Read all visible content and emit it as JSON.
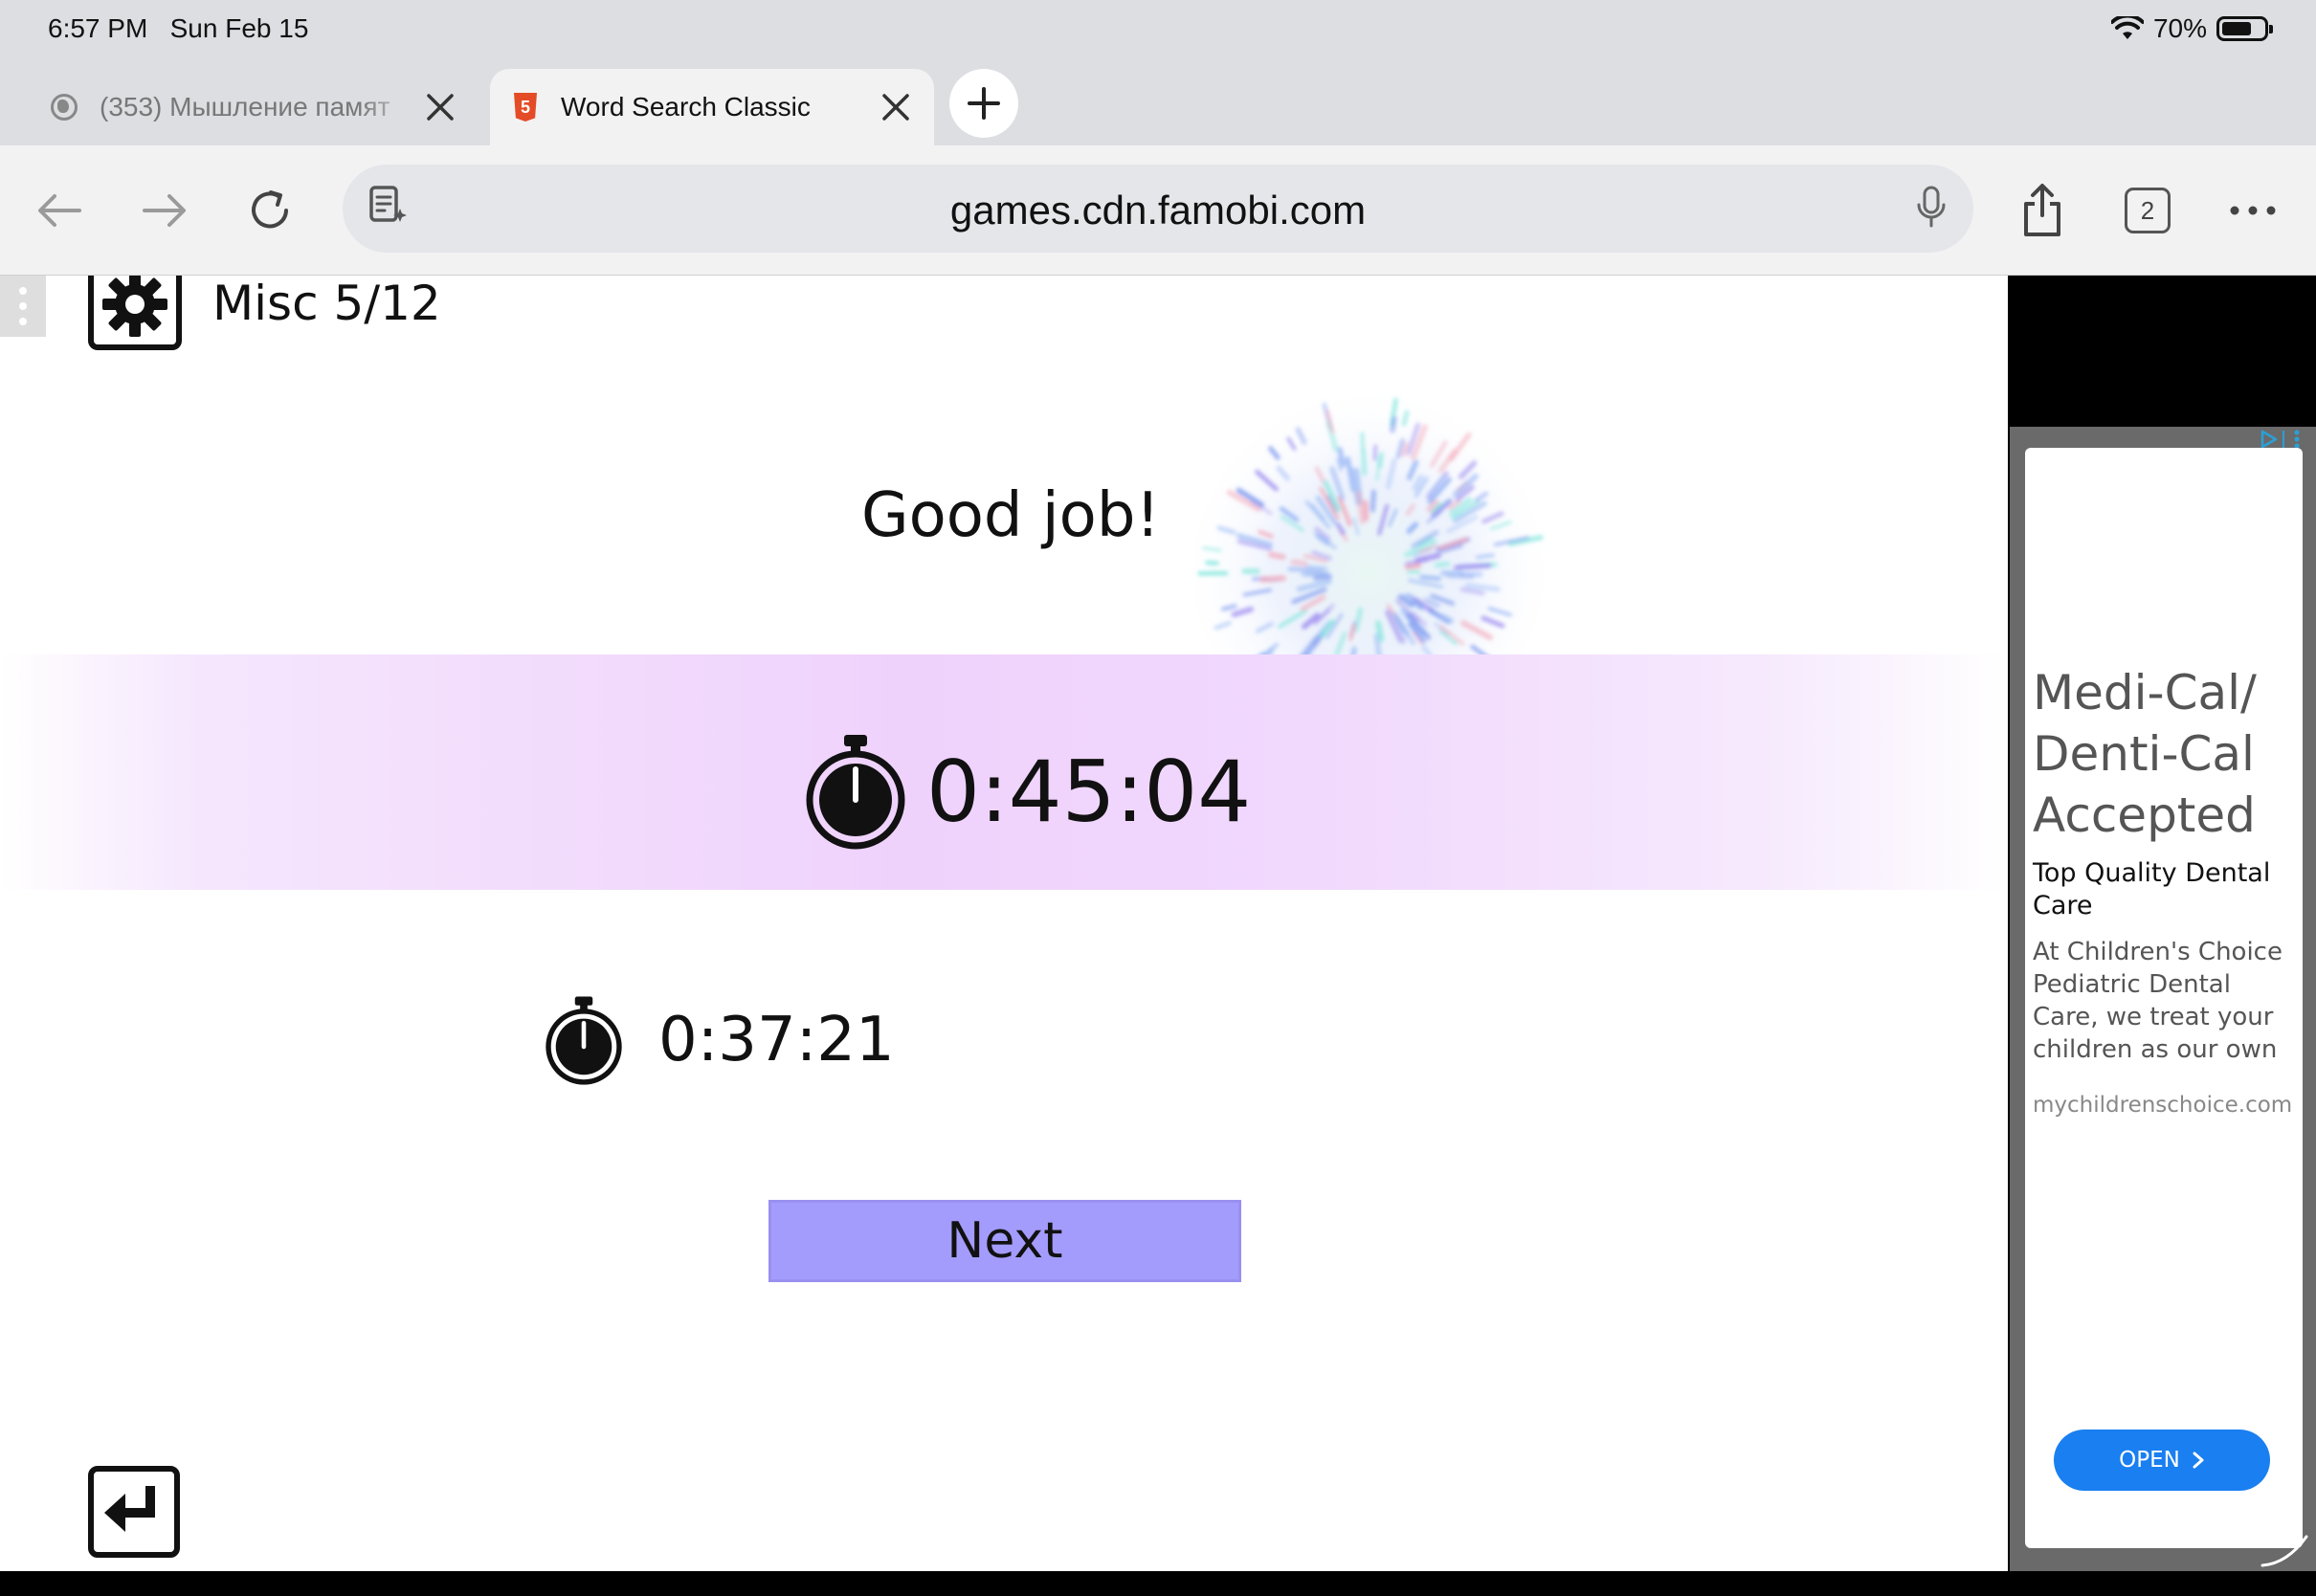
{
  "status_bar": {
    "time": "6:57 PM",
    "date": "Sun Feb 15",
    "battery": "70%"
  },
  "tabs": [
    {
      "title": "(353) Мышление памят",
      "icon": "globe-icon",
      "active": false
    },
    {
      "title": "Word Search Classic",
      "icon": "html5-icon",
      "active": true
    }
  ],
  "toolbar": {
    "url": "games.cdn.famobi.com",
    "tab_count": "2"
  },
  "game": {
    "level_label": "Misc 5/12",
    "message": "Good job!",
    "current_time": "0:45:04",
    "best_time": "0:37:21",
    "next_label": "Next",
    "colors": {
      "band": "#efd2fc",
      "next_button": "#a49cfc"
    }
  },
  "ad": {
    "headline": "Medi-Cal/ Denti-Cal Accepted",
    "subtitle": "Top Quality Dental Care",
    "body": "At Children's Choice Pediatric Dental Care, we treat your children as our own",
    "domain": "mychildrenschoice.com",
    "cta": "OPEN",
    "colors": {
      "cta": "#1a7ff0"
    }
  }
}
